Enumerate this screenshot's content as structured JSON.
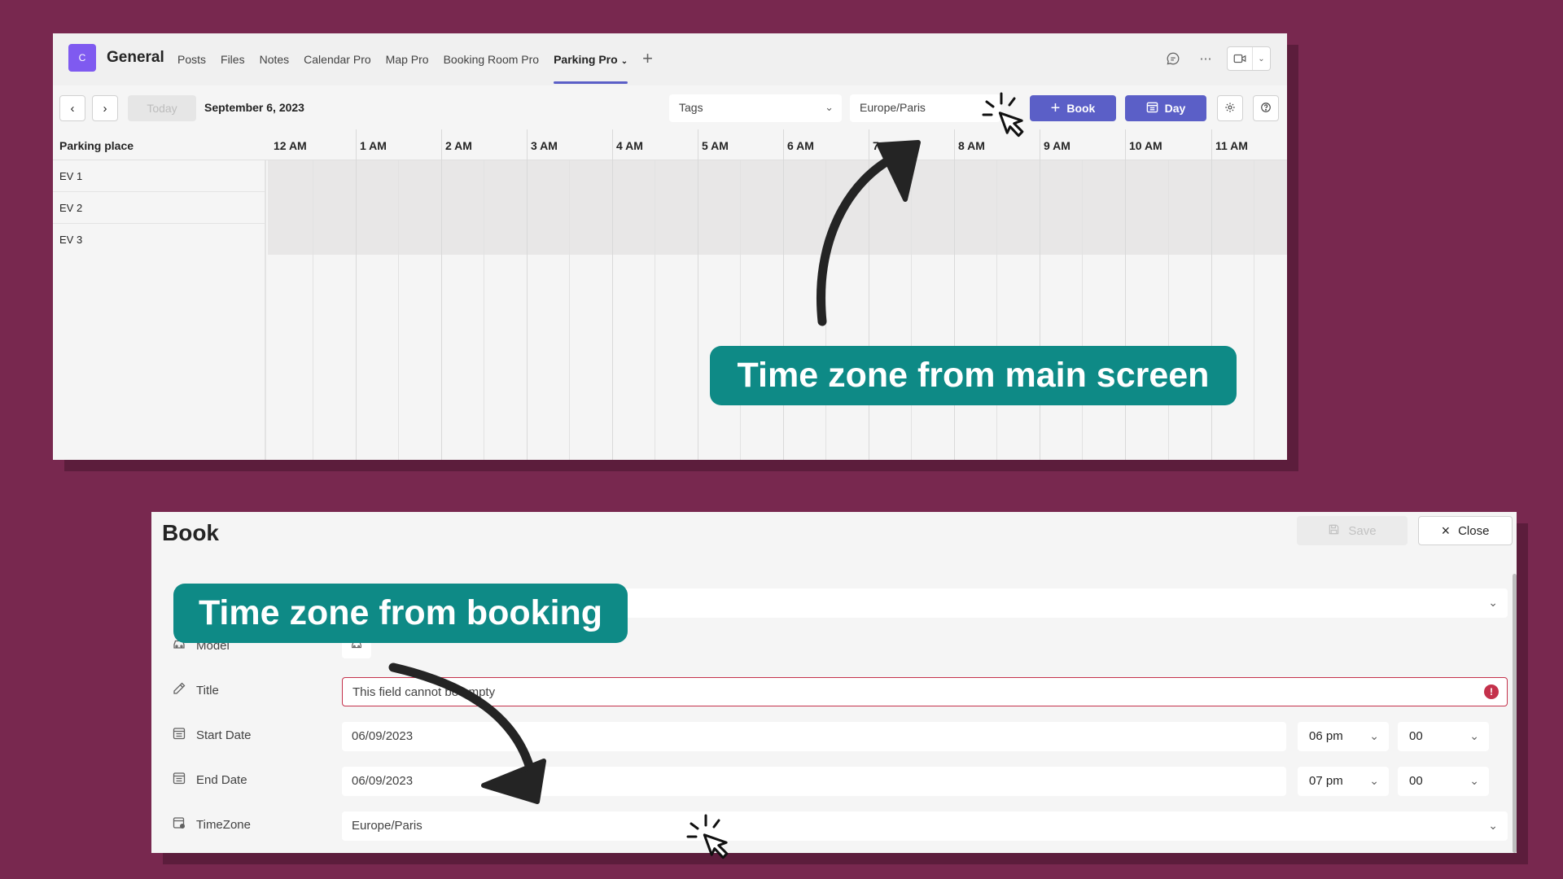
{
  "main_screen": {
    "team": {
      "avatar_letter": "C",
      "name": "General"
    },
    "tabs": [
      "Posts",
      "Files",
      "Notes",
      "Calendar Pro",
      "Map Pro",
      "Booking Room Pro",
      "Parking Pro"
    ],
    "active_tab": "Parking Pro",
    "toolbar": {
      "today_label": "Today",
      "date": "September 6, 2023",
      "tags_placeholder": "Tags",
      "timezone": "Europe/Paris",
      "book_label": "Book",
      "view_label": "Day"
    },
    "grid": {
      "column_title": "Parking place",
      "hours": [
        "12 AM",
        "1 AM",
        "2 AM",
        "3 AM",
        "4 AM",
        "5 AM",
        "6 AM",
        "7 AM",
        "8 AM",
        "9 AM",
        "10 AM",
        "11 AM"
      ],
      "rows": [
        "EV 1",
        "EV 2",
        "EV 3"
      ]
    }
  },
  "booking": {
    "title": "Book",
    "save_label": "Save",
    "close_label": "Close",
    "fields": {
      "model_label": "Model",
      "title_label": "Title",
      "title_error": "This field cannot be empty",
      "start_label": "Start Date",
      "start_date": "06/09/2023",
      "start_hour": "06 pm",
      "start_minute": "00",
      "end_label": "End Date",
      "end_date": "06/09/2023",
      "end_hour": "07 pm",
      "end_minute": "00",
      "timezone_label": "TimeZone",
      "timezone": "Europe/Paris"
    }
  },
  "callouts": {
    "main": "Time zone from main screen",
    "booking": "Time zone from booking"
  },
  "colors": {
    "background": "#78284f",
    "accent": "#5b5fc7",
    "callout": "#0e8a86",
    "error": "#c4314b"
  }
}
